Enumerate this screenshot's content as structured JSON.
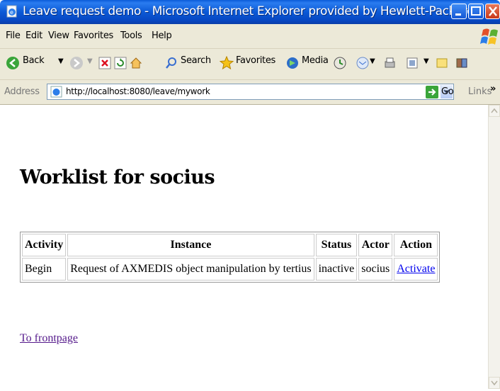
{
  "window": {
    "title": "Leave request demo - Microsoft Internet Explorer provided by Hewlett-Packard"
  },
  "menubar": {
    "items": [
      "File",
      "Edit",
      "View",
      "Favorites",
      "Tools",
      "Help"
    ]
  },
  "toolbar": {
    "back_label": "Back",
    "search_label": "Search",
    "favorites_label": "Favorites",
    "media_label": "Media"
  },
  "addressbar": {
    "label": "Address",
    "url": "http://localhost:8080/leave/mywork",
    "go_label": "Go",
    "links_label": "Links"
  },
  "page": {
    "heading": "Worklist for socius",
    "table": {
      "headers": [
        "Activity",
        "Instance",
        "Status",
        "Actor",
        "Action"
      ],
      "rows": [
        [
          "Begin",
          "Request of AXMEDIS object manipulation by tertius",
          "inactive",
          "socius",
          "Activate"
        ]
      ]
    },
    "frontpage_link": "To frontpage"
  },
  "colors": {
    "titlebar_blue": "#0b59d6",
    "chrome": "#ece9d8",
    "link": "#0000ee",
    "visited_link": "#551a8b"
  }
}
